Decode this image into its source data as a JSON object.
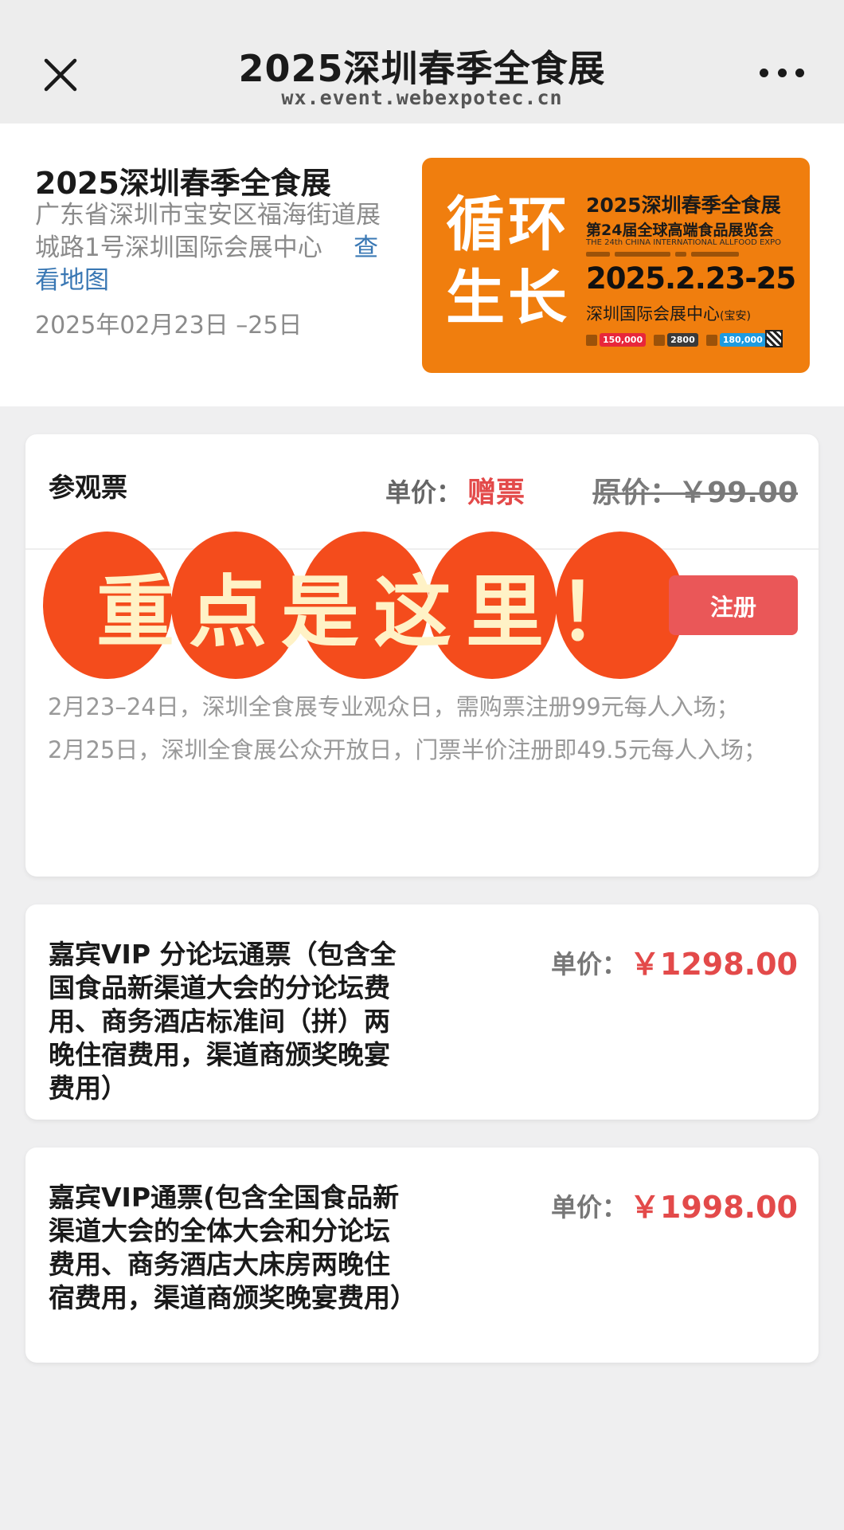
{
  "topbar": {
    "title": "2025深圳春季全食展",
    "url": "wx.event.webexpotec.cn"
  },
  "event": {
    "name": "2025深圳春季全食展",
    "address": "广东省深圳市宝安区福海街道展城路1号深圳国际会展中心",
    "map_link": "查看地图",
    "date": "2025年02月23日 –25日"
  },
  "poster": {
    "slogan": "循环生长",
    "title": "2025深圳春季全食展",
    "subtitle": "第24届全球高端食品展览会",
    "english": "THE 24th CHINA INTERNATIONAL ALLFOOD EXPO",
    "dates": "2025.2.23-25",
    "venue": "深圳国际会展中心",
    "venue_note": "(宝安)",
    "stats": [
      {
        "value": "150,000",
        "color": "#e8273a"
      },
      {
        "value": "2800",
        "color": "#3a3a3a"
      },
      {
        "value": "180,000",
        "color": "#1e9be0"
      }
    ]
  },
  "tickets": [
    {
      "name": "参观票",
      "price_label": "单价：",
      "price": "赠票",
      "original_price": "原价：￥99.00",
      "banner": "重点是这里！",
      "button": "注册",
      "desc_1": "2月23–24日，深圳全食展专业观众日，需购票注册99元每人入场；",
      "desc_2": "2月25日，深圳全食展公众开放日，门票半价注册即49.5元每人入场；"
    },
    {
      "name": "嘉宾VIP 分论坛通票（包含全国食品新渠道大会的分论坛费用、商务酒店标准间（拼）两晚住宿费用，渠道商颁奖晚宴费用）",
      "price_label": "单价：",
      "price": "￥1298.00"
    },
    {
      "name": "嘉宾VIP通票(包含全国食品新渠道大会的全体大会和分论坛费用、商务酒店大床房两晚住宿费用，渠道商颁奖晚宴费用）",
      "price_label": "单价：",
      "price": "￥1998.00"
    }
  ]
}
